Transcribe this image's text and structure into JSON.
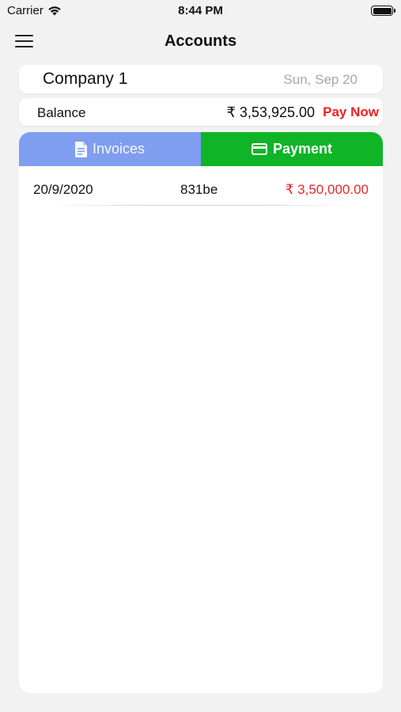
{
  "status_bar": {
    "carrier": "Carrier",
    "time": "8:44 PM"
  },
  "nav": {
    "title": "Accounts",
    "menu_icon": "hamburger-icon"
  },
  "company": {
    "name": "Company 1",
    "date": "Sun, Sep 20"
  },
  "balance": {
    "label": "Balance",
    "amount": "₹ 3,53,925.00",
    "pay_now_label": "Pay Now"
  },
  "tabs": [
    {
      "label": "Invoices",
      "icon": "document-icon",
      "active": false
    },
    {
      "label": "Payment",
      "icon": "credit-card-icon",
      "active": true
    }
  ],
  "payments": [
    {
      "date": "20/9/2020",
      "ref": "831be",
      "amount": "₹ 3,50,000.00"
    }
  ],
  "colors": {
    "invoices_tab": "#7f9ef0",
    "payment_tab": "#0fb427",
    "negative_amount": "#e5262a",
    "pay_now": "#f01f1f",
    "background": "#f2f2f2"
  }
}
